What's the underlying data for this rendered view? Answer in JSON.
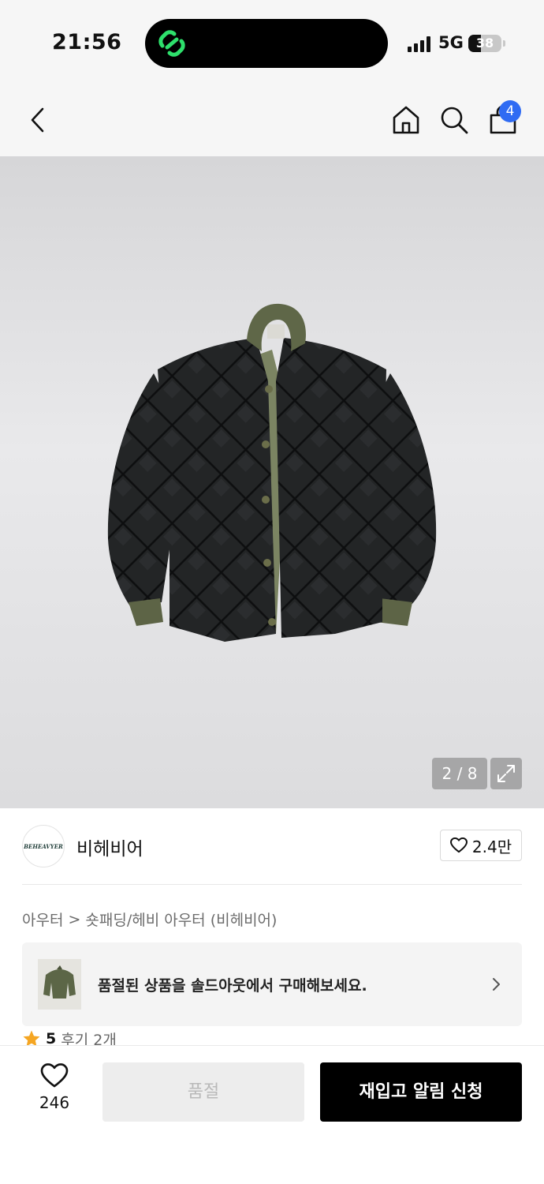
{
  "status_bar": {
    "time": "21:56",
    "network": "5G",
    "battery": "38",
    "battery_level": 0.38
  },
  "nav": {
    "cart_count": "4",
    "icons": [
      "back-icon",
      "home-icon",
      "search-icon",
      "cart-icon"
    ]
  },
  "gallery": {
    "page_indicator": "2 / 8"
  },
  "brand": {
    "logo_text": "BEHEAVYER",
    "name": "비헤비어",
    "like_count": "2.4만"
  },
  "breadcrumb": {
    "items": [
      "아우터",
      "숏패딩/헤비 아우터 (비헤비어)"
    ],
    "separator": ">"
  },
  "banner": {
    "text": "품절된 상품을 솔드아웃에서 구매해보세요."
  },
  "rating": {
    "score": "5",
    "reviews": "후기 2개"
  },
  "bottom": {
    "wish_count": "246",
    "soldout_label": "품절",
    "restock_label": "재입고 알림 신청"
  },
  "colors": {
    "accent_badge": "#2f6bf3",
    "star": "#f5a623",
    "primary_button": "#000000"
  }
}
